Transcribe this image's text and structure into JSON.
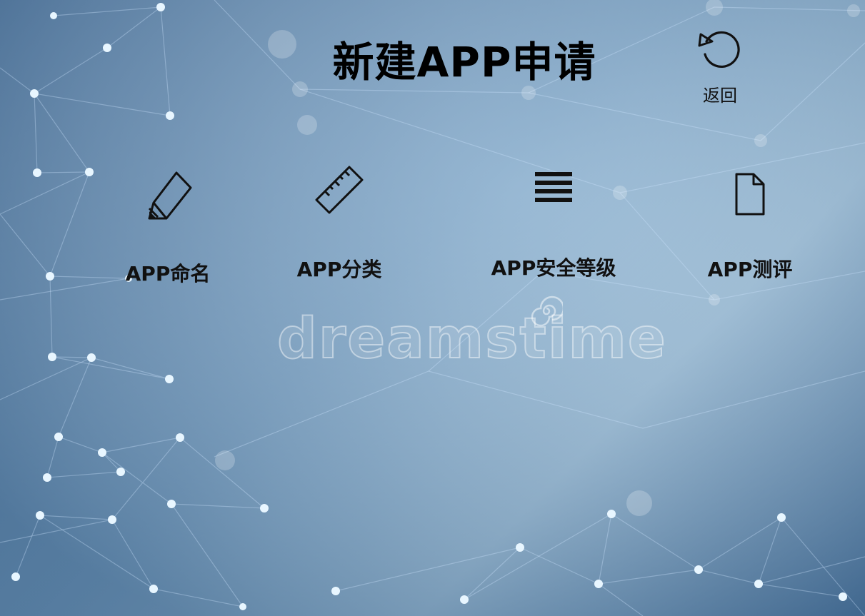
{
  "page": {
    "title": "新建APP申请",
    "background_color": "#7ea6c8"
  },
  "header": {
    "back": {
      "label": "返回",
      "icon": "undo-icon"
    }
  },
  "menu": {
    "items": [
      {
        "label": "APP命名",
        "icon": "pencil-icon"
      },
      {
        "label": "APP分类",
        "icon": "ruler-icon"
      },
      {
        "label": "APP安全等级",
        "icon": "list-lines-icon"
      },
      {
        "label": "APP测评",
        "icon": "document-icon"
      }
    ]
  },
  "watermark": {
    "text": "dreamstime"
  }
}
